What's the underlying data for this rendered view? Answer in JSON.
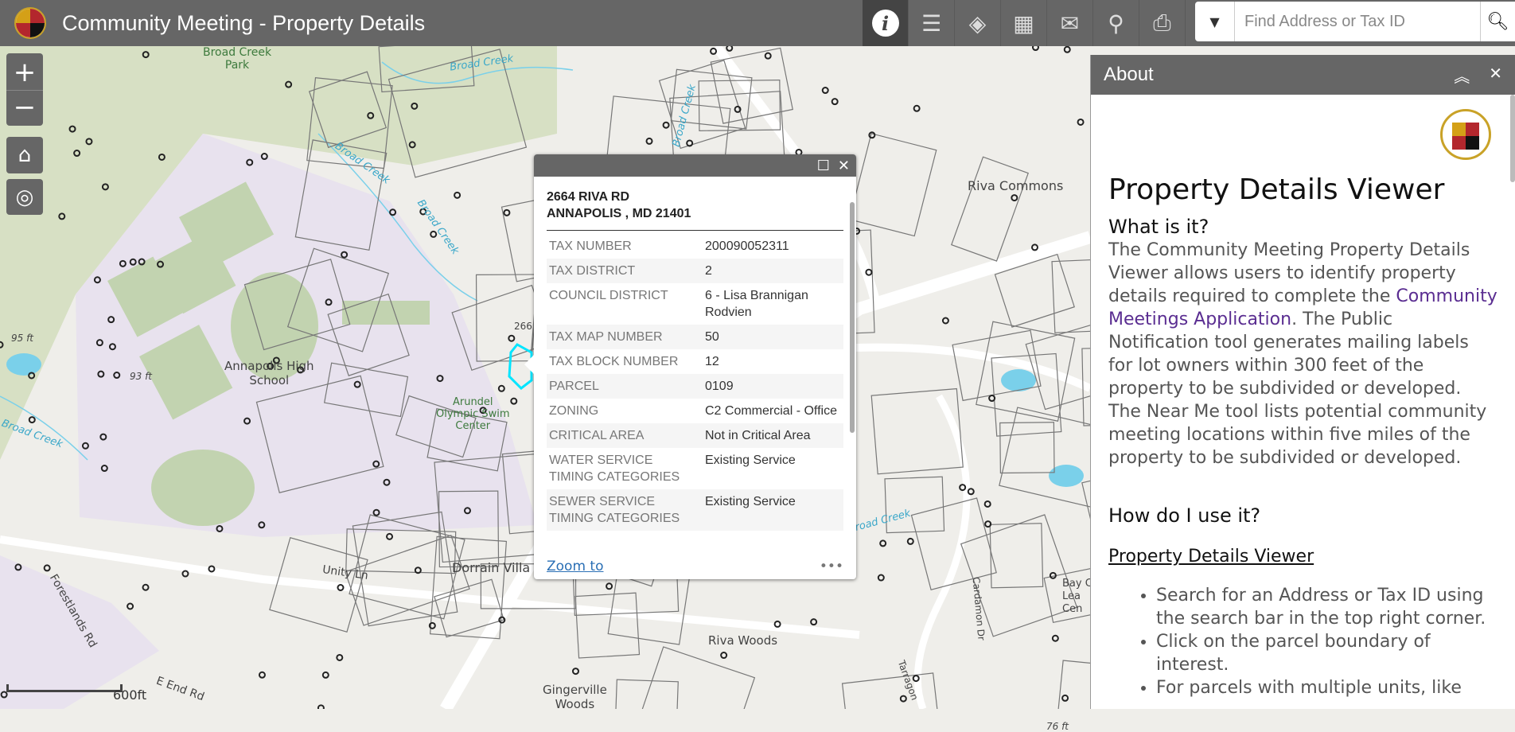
{
  "header": {
    "title": "Community Meeting - Property Details",
    "logo": "Anne Arundel County seal"
  },
  "toolbar": [
    {
      "icon": "info-icon",
      "label": "About",
      "active": true
    },
    {
      "icon": "legend-icon",
      "label": "Legend"
    },
    {
      "icon": "layers-icon",
      "label": "Layers"
    },
    {
      "icon": "basemap-gallery-icon",
      "label": "Basemap Gallery"
    },
    {
      "icon": "mail-icon",
      "label": "Public Notification"
    },
    {
      "icon": "near-me-icon",
      "label": "Near Me"
    },
    {
      "icon": "print-icon",
      "label": "Print"
    }
  ],
  "search": {
    "placeholder": "Find Address or Tax ID",
    "value": ""
  },
  "map_labels": {
    "park": "Broad Creek\nPark",
    "creek": "Broad Creek",
    "elev1": "95 ft",
    "elev2": "93 ft",
    "school": "Annapolis High\nSchool",
    "swim": "Arundel\nOlympic Swim\nCenter",
    "riva_commons": "Riva Commons",
    "dorrain": "Dorrain Villa",
    "unity": "Unity Ln",
    "forestlands": "Forestlands Rd",
    "riva_woods": "Riva Woods",
    "gingerville": "Gingerville\nWoods",
    "eend": "E End Rd",
    "bay": "Bay C\nLea\nCen",
    "cardamon": "Cardamon Dr",
    "tarragon": "Tarragon",
    "elev3": "76 ft",
    "num": "266"
  },
  "scale": {
    "label": "600ft"
  },
  "popup": {
    "address_line1": "2664 RIVA RD",
    "address_line2": "ANNAPOLIS , MD 21401",
    "rows": [
      {
        "k": "TAX NUMBER",
        "v": "200090052311"
      },
      {
        "k": "TAX DISTRICT",
        "v": "2"
      },
      {
        "k": "COUNCIL DISTRICT",
        "v": "6 - Lisa Brannigan Rodvien"
      },
      {
        "k": "TAX MAP NUMBER",
        "v": "50"
      },
      {
        "k": "TAX BLOCK NUMBER",
        "v": "12"
      },
      {
        "k": "PARCEL",
        "v": "0109"
      },
      {
        "k": "ZONING",
        "v": "C2 Commercial - Office"
      },
      {
        "k": "CRITICAL AREA",
        "v": "Not in Critical Area"
      },
      {
        "k": "WATER SERVICE TIMING CATEGORIES",
        "v": "Existing Service"
      },
      {
        "k": "SEWER SERVICE TIMING CATEGORIES",
        "v": "Existing Service"
      }
    ],
    "zoom_to": "Zoom to",
    "more": "•••"
  },
  "about": {
    "title": "About",
    "heading": "Property Details Viewer",
    "what_heading": "What is it?",
    "what_text1": "The Community Meeting Property Details Viewer allows users to identify property details required to complete the ",
    "what_link": "Community Meetings Application",
    "what_text2": ". The Public Notification tool generates mailing labels for lot owners within 300 feet of the property to be subdivided or developed. The Near Me tool lists potential community meeting locations within five miles of the property to be subdivided or developed.",
    "how_heading": "How do I use it?",
    "sub_heading": "Property Details Viewer",
    "steps": [
      "Search for an Address or Tax ID using the search bar in the top right corner.",
      "Click on the parcel boundary of interest.",
      "For parcels with multiple units, like"
    ]
  },
  "colors": {
    "header": "#666666",
    "school": "#e8e2ee",
    "terrain": "#d7e0c4",
    "field": "#c2d3b0",
    "water": "#7ad0ea",
    "highlight": "#00e5ff",
    "link": "#5a2d91"
  }
}
